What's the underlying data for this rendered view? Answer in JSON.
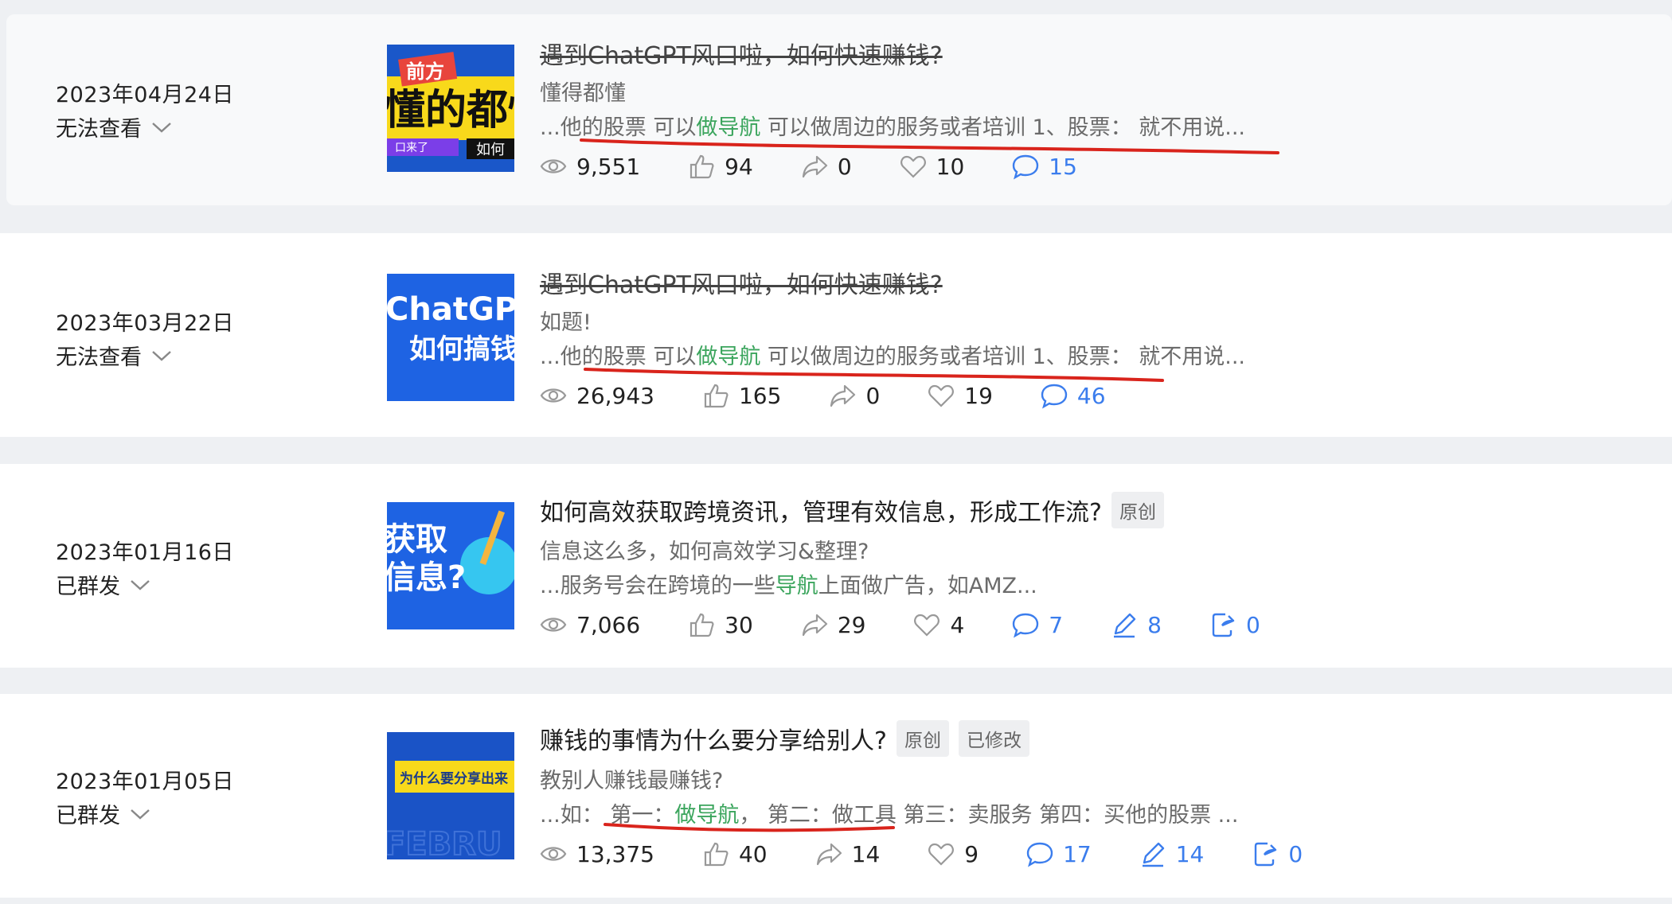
{
  "articles": [
    {
      "date": "2023年04月24日",
      "status": "无法查看",
      "title": "遇到ChatGPT风口啦，如何快速赚钱?",
      "desc": "懂得都懂",
      "excerpt": {
        "pre": "...他的股票 可以",
        "hl": "做导航",
        "post": " 可以做周边的服务或者培训 1、股票： 就不用说..."
      },
      "stats": {
        "views": "9,551",
        "likes": "94",
        "shares": "0",
        "favorites": "10",
        "comments": "15"
      },
      "thumb": {
        "line1": "前方",
        "line2": "懂的都懂",
        "line3": "口来了",
        "line4": "如何"
      }
    },
    {
      "date": "2023年03月22日",
      "status": "无法查看",
      "title": "遇到ChatGPT风口啦，如何快速赚钱?",
      "desc": "如题!",
      "excerpt": {
        "pre": "...他的股票 可以",
        "hl": "做导航",
        "post": " 可以做周边的服务或者培训 1、股票： 就不用说..."
      },
      "stats": {
        "views": "26,943",
        "likes": "165",
        "shares": "0",
        "favorites": "19",
        "comments": "46"
      },
      "thumb": {
        "line1": "ChatGPT",
        "line2": "如何搞钱"
      }
    },
    {
      "date": "2023年01月16日",
      "status": "已群发",
      "title": "如何高效获取跨境资讯，管理有效信息，形成工作流?",
      "tags": [
        "原创"
      ],
      "desc": "信息这么多，如何高效学习&整理?",
      "excerpt": {
        "pre": "...服务号会在跨境的一些",
        "hl": "导航",
        "post": "上面做广告，如AMZ..."
      },
      "stats": {
        "views": "7,066",
        "likes": "30",
        "shares": "29",
        "favorites": "4",
        "comments": "7",
        "edits": "8",
        "reposts": "0"
      },
      "thumb": {
        "line1": "获取",
        "line2": "信息?"
      }
    },
    {
      "date": "2023年01月05日",
      "status": "已群发",
      "title": "赚钱的事情为什么要分享给别人?",
      "tags": [
        "原创",
        "已修改"
      ],
      "desc": "教别人赚钱最赚钱?",
      "excerpt": {
        "pre": "...如：  第一：",
        "hl": "做导航",
        "post": "，  第二：做工具 第三：卖服务 第四：买他的股票 ..."
      },
      "stats": {
        "views": "13,375",
        "likes": "40",
        "shares": "14",
        "favorites": "9",
        "comments": "17",
        "edits": "14",
        "reposts": "0"
      },
      "thumb": {
        "line1": "为什么要分享出来",
        "line2": "FEBRU"
      }
    }
  ],
  "colors": {
    "highlight": "#3ba55d",
    "accent": "#3b7ded",
    "annotation": "#d9241c"
  }
}
